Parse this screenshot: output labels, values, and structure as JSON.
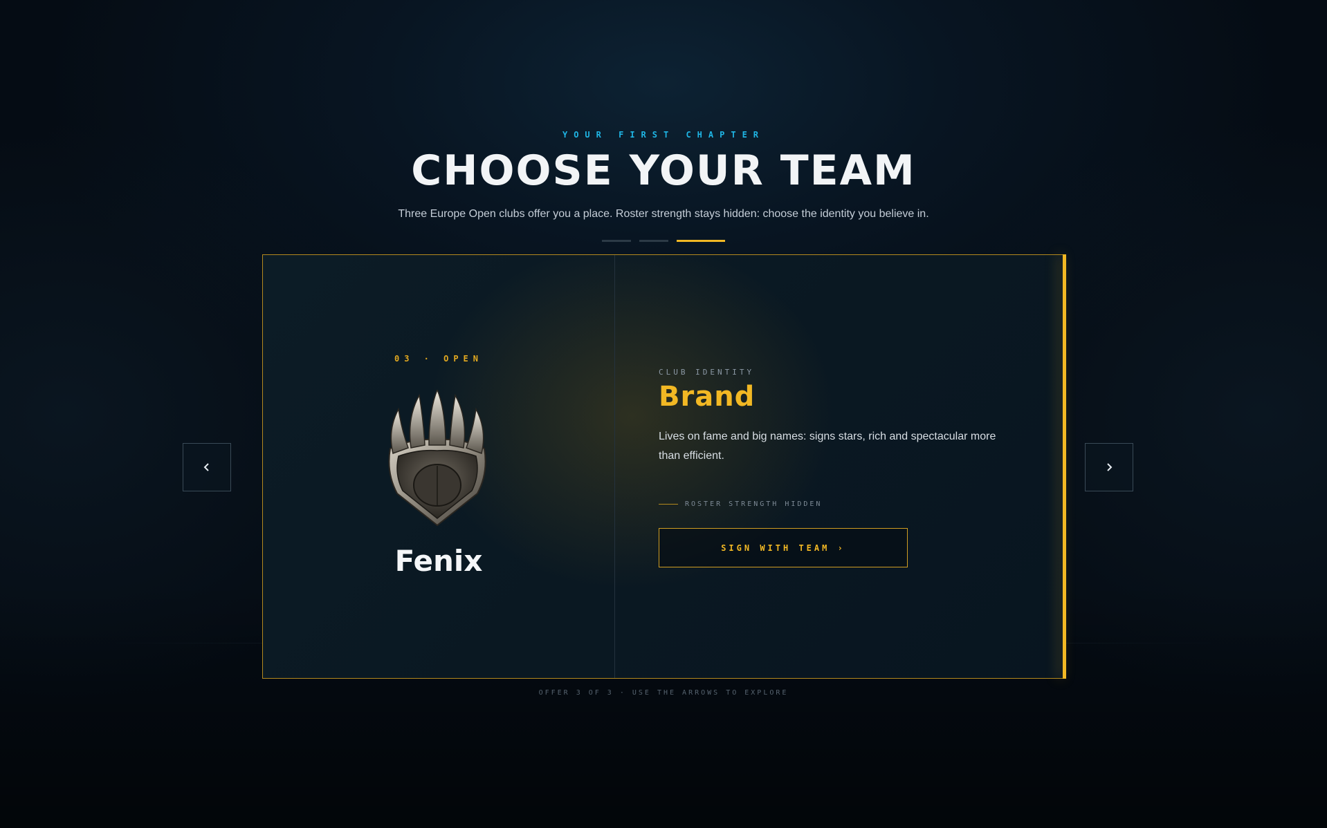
{
  "header": {
    "eyebrow": "YOUR FIRST CHAPTER",
    "title": "CHOOSE YOUR TEAM",
    "subtitle": "Three Europe Open clubs offer you a place. Roster strength stays hidden: choose the identity you believe in."
  },
  "pager": {
    "total": 3,
    "active_index": 3
  },
  "card": {
    "seed_label": "03 · OPEN",
    "crest_icon": "claw-crest-icon",
    "team_name": "Fenix",
    "identity_label": "CLUB IDENTITY",
    "identity_value": "Brand",
    "identity_description": "Lives on fame and big names: signs stars, rich and spectacular more than efficient.",
    "hidden_note": "ROSTER STRENGTH HIDDEN",
    "sign_button": "SIGN WITH TEAM ›"
  },
  "nav": {
    "prev_icon": "chevron-left-icon",
    "next_icon": "chevron-right-icon"
  },
  "footer_hint": "OFFER 3 OF 3 · USE THE ARROWS TO EXPLORE",
  "colors": {
    "accent_gold": "#f2b824",
    "accent_cyan": "#1fb6e6",
    "background": "#081522"
  }
}
